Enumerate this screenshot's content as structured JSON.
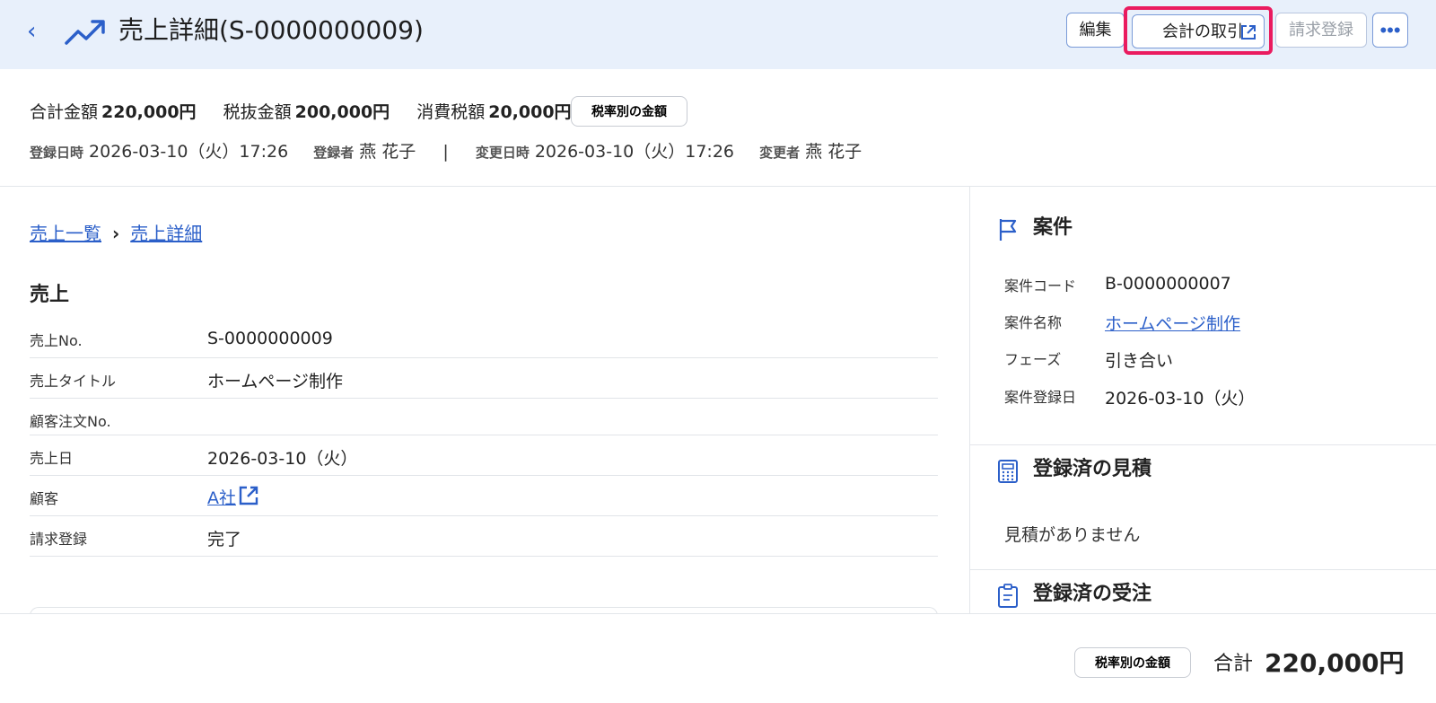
{
  "header": {
    "title": "売上詳細(S-0000000009)",
    "buttons": {
      "edit": "編集",
      "accounting": "会計の取引",
      "invoice_register": "請求登録",
      "more": "•••"
    }
  },
  "summary": {
    "total_label": "合計金額",
    "total_value": "220,000円",
    "pretax_label": "税抜金額",
    "pretax_value": "200,000円",
    "tax_label": "消費税額",
    "tax_value": "20,000円",
    "tax_rate_button": "税率別の金額",
    "registered_at_label": "登録日時",
    "registered_at": "2026-03-10（火）17:26",
    "registered_by_label": "登録者",
    "registered_by": "燕 花子",
    "separator": "|",
    "updated_at_label": "変更日時",
    "updated_at": "2026-03-10（火）17:26",
    "updated_by_label": "変更者",
    "updated_by": "燕 花子"
  },
  "breadcrumb": {
    "items": [
      "売上一覧",
      "売上詳細"
    ]
  },
  "sales": {
    "section_title": "売上",
    "rows": [
      {
        "label": "売上No.",
        "value": "S-0000000009"
      },
      {
        "label": "売上タイトル",
        "value": "ホームページ制作"
      },
      {
        "label": "顧客注文No.",
        "value": ""
      },
      {
        "label": "売上日",
        "value": "2026-03-10（火）"
      },
      {
        "label": "顧客",
        "value": "A社"
      },
      {
        "label": "請求登録",
        "value": "完了"
      }
    ]
  },
  "project": {
    "title": "案件",
    "rows": [
      {
        "label": "案件コード",
        "value": "B-0000000007"
      },
      {
        "label": "案件名称",
        "value": "ホームページ制作"
      },
      {
        "label": "フェーズ",
        "value": "引き合い"
      },
      {
        "label": "案件登録日",
        "value": "2026-03-10（火）"
      }
    ]
  },
  "estimates": {
    "title": "登録済の見積",
    "empty": "見積がありません"
  },
  "orders": {
    "title": "登録済の受注"
  },
  "footer": {
    "tax_rate_button": "税率別の金額",
    "total_label": "合計",
    "total_value": "220,000円"
  },
  "colors": {
    "accent": "#2b5fc9",
    "highlight": "#ea1b5f",
    "header_bg": "#e8f0fb"
  }
}
